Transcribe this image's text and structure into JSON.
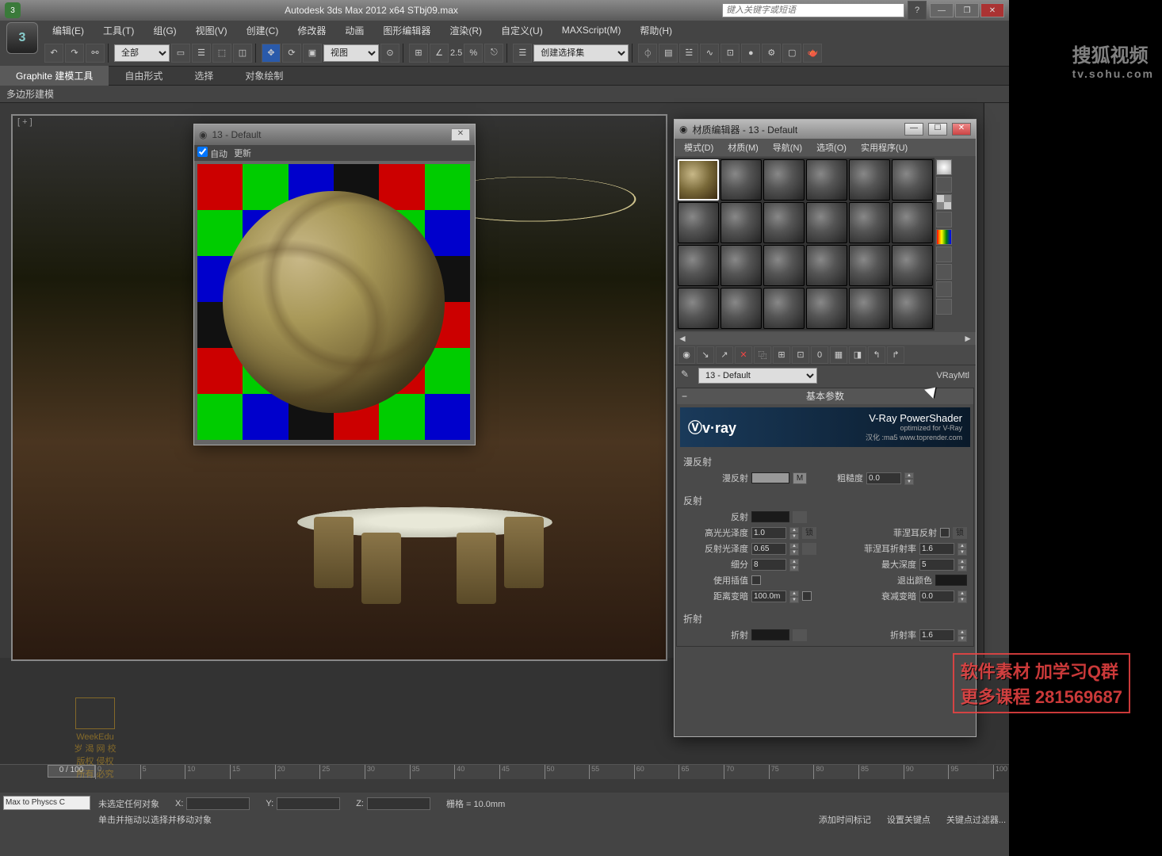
{
  "titlebar": {
    "app_title": "Autodesk 3ds Max  2012 x64     STbj09.max",
    "search_placeholder": "键入关键字或短语"
  },
  "menubar": {
    "items": [
      "编辑(E)",
      "工具(T)",
      "组(G)",
      "视图(V)",
      "创建(C)",
      "修改器",
      "动画",
      "图形编辑器",
      "渲染(R)",
      "自定义(U)",
      "MAXScript(M)",
      "帮助(H)"
    ]
  },
  "toolbar": {
    "combo_all": "全部",
    "combo_view": "视图",
    "snap_value": "2.5",
    "combo_selset": "创建选择集"
  },
  "ribbon": {
    "tabs": [
      "Graphite 建模工具",
      "自由形式",
      "选择",
      "对象绘制"
    ],
    "sub": "多边形建模"
  },
  "preview": {
    "title": "13 - Default",
    "auto": "自动",
    "update": "更新"
  },
  "material_editor": {
    "title": "材质编辑器 - 13 - Default",
    "menu": [
      "模式(D)",
      "材质(M)",
      "导航(N)",
      "选项(O)",
      "实用程序(U)"
    ],
    "name": "13 - Default",
    "type": "VRayMtl",
    "rollout_basic": "基本参数",
    "vray_brand": "Ⓥv·ray",
    "vray_title": "V-Ray PowerShader",
    "vray_sub": "optimized for V-Ray",
    "vray_credit": "汉化 :ma5  www.toprender.com",
    "diffuse_section": "漫反射",
    "diffuse_label": "漫反射",
    "roughness_label": "粗糙度",
    "roughness_val": "0.0",
    "reflect_section": "反射",
    "reflect_label": "反射",
    "hilight_label": "高光光泽度",
    "hilight_val": "1.0",
    "lock_label": "锁",
    "fresnel_label": "菲涅耳反射",
    "reflgloss_label": "反射光泽度",
    "reflgloss_val": "0.65",
    "fresnel_ior_label": "菲涅耳折射率",
    "fresnel_ior_val": "1.6",
    "subdiv_label": "细分",
    "subdiv_val": "8",
    "maxdepth_label": "最大深度",
    "maxdepth_val": "5",
    "interp_label": "使用插值",
    "exitcolor_label": "退出颜色",
    "dimdist_label": "距离变暗",
    "dimdist_val": "100.0m",
    "dimfall_label": "衰减变暗",
    "dimfall_val": "0.0",
    "refract_section": "折射",
    "refract_label": "折射",
    "ior_label": "折射率",
    "ior_val": "1.6"
  },
  "timeline": {
    "frame_display": "0 / 100"
  },
  "statusbar": {
    "maxscript": "Max to Physcs C",
    "no_select": "未选定任何对象",
    "prompt": "单击并拖动以选择并移动对象",
    "x_label": "X:",
    "y_label": "Y:",
    "z_label": "Z:",
    "grid": "栅格 = 10.0mm",
    "add_time": "添加时间标记",
    "setkey": "设置关键点",
    "keyfilter": "关键点过滤器..."
  },
  "watermark": {
    "brand": "WeekEdu",
    "sub1": "岁 渴 网 校",
    "sub2": "版权  侵权",
    "sub3": "所有  必究"
  },
  "sohu": {
    "logo": "搜狐视频",
    "url": "tv.sohu.com"
  },
  "overlay": {
    "line1": "软件素材 加学习Q群",
    "line2": "更多课程 281569687"
  },
  "ticks": [
    0,
    5,
    10,
    15,
    20,
    25,
    30,
    35,
    40,
    45,
    50,
    55,
    60,
    65,
    70,
    75,
    80,
    85,
    90,
    95,
    100
  ]
}
